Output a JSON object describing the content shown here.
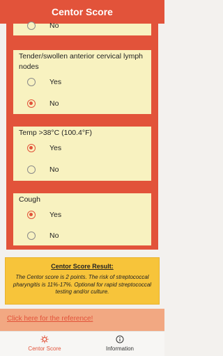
{
  "header": {
    "title": "Centor Score"
  },
  "criteria": [
    {
      "title": "",
      "options": [
        {
          "label": "No",
          "selected": false
        }
      ]
    },
    {
      "title": "Tender/swollen anterior cervical lymph nodes",
      "options": [
        {
          "label": "Yes",
          "selected": false
        },
        {
          "label": "No",
          "selected": true
        }
      ]
    },
    {
      "title": "Temp >38°C (100.4°F)",
      "options": [
        {
          "label": "Yes",
          "selected": true
        },
        {
          "label": "No",
          "selected": false
        }
      ]
    },
    {
      "title": "Cough",
      "options": [
        {
          "label": "Yes",
          "selected": true
        },
        {
          "label": "No",
          "selected": false
        }
      ]
    }
  ],
  "result": {
    "title": "Centor Score Result:",
    "text": "The Centor score is 2 points. The risk of streptococcal pharyngitis is 11%-17%. Optional for rapid streptococcal testing and/or culture."
  },
  "reference": {
    "link_text": "Click here for the reference!"
  },
  "tabbar": {
    "items": [
      {
        "label": "Centor Score",
        "icon": "virus-icon",
        "active": true,
        "color": "#e2533a"
      },
      {
        "label": "Information",
        "icon": "info-icon",
        "active": false
      }
    ]
  },
  "colors": {
    "accent": "#e2533a",
    "card": "#f8f2c0",
    "result": "#f7c43a",
    "reference_bg": "#f2a882"
  }
}
